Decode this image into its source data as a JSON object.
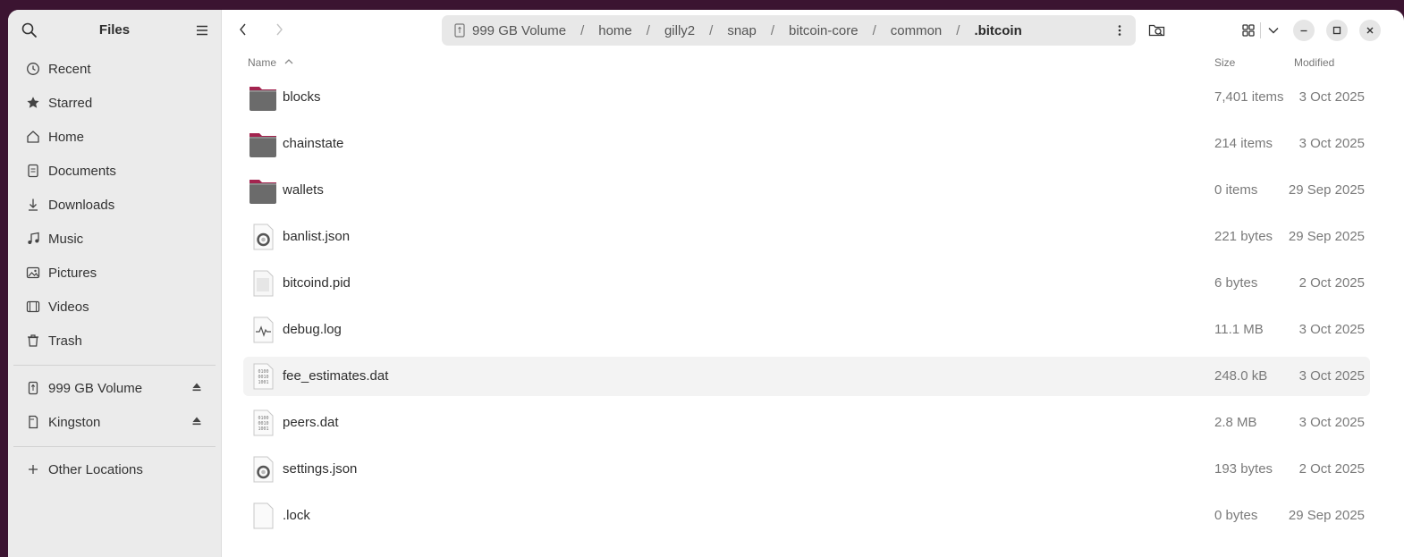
{
  "sidebar": {
    "title": "Files",
    "places": [
      {
        "label": "Recent",
        "icon": "clock-icon"
      },
      {
        "label": "Starred",
        "icon": "star-icon"
      },
      {
        "label": "Home",
        "icon": "home-icon"
      },
      {
        "label": "Documents",
        "icon": "document-icon"
      },
      {
        "label": "Downloads",
        "icon": "download-icon"
      },
      {
        "label": "Music",
        "icon": "music-icon"
      },
      {
        "label": "Pictures",
        "icon": "picture-icon"
      },
      {
        "label": "Videos",
        "icon": "video-icon"
      },
      {
        "label": "Trash",
        "icon": "trash-icon"
      }
    ],
    "devices": [
      {
        "label": "999 GB Volume",
        "icon": "usb-drive-icon"
      },
      {
        "label": "Kingston",
        "icon": "sd-card-icon"
      }
    ],
    "other": {
      "label": "Other Locations",
      "icon": "plus-icon"
    }
  },
  "path": {
    "segments": [
      "999 GB Volume",
      "home",
      "gilly2",
      "snap",
      "bitcoin-core",
      "common",
      ".bitcoin"
    ]
  },
  "columns": {
    "name": "Name",
    "size": "Size",
    "modified": "Modified"
  },
  "files": [
    {
      "name": "blocks",
      "size": "7,401 items",
      "modified": "3 Oct 2025",
      "type": "folder"
    },
    {
      "name": "chainstate",
      "size": "214 items",
      "modified": "3 Oct 2025",
      "type": "folder"
    },
    {
      "name": "wallets",
      "size": "0 items",
      "modified": "29 Sep 2025",
      "type": "folder"
    },
    {
      "name": "banlist.json",
      "size": "221 bytes",
      "modified": "29 Sep 2025",
      "type": "json"
    },
    {
      "name": "bitcoind.pid",
      "size": "6 bytes",
      "modified": "2 Oct 2025",
      "type": "text"
    },
    {
      "name": "debug.log",
      "size": "11.1 MB",
      "modified": "3 Oct 2025",
      "type": "log"
    },
    {
      "name": "fee_estimates.dat",
      "size": "248.0 kB",
      "modified": "3 Oct 2025",
      "type": "binary"
    },
    {
      "name": "peers.dat",
      "size": "2.8 MB",
      "modified": "3 Oct 2025",
      "type": "binary"
    },
    {
      "name": "settings.json",
      "size": "193 bytes",
      "modified": "2 Oct 2025",
      "type": "json"
    },
    {
      "name": ".lock",
      "size": "0 bytes",
      "modified": "29 Sep 2025",
      "type": "empty"
    }
  ],
  "colors": {
    "folder": "#6b6b6b",
    "folder_tab": "#a3244f",
    "desktop_bg": "#3b1431"
  }
}
